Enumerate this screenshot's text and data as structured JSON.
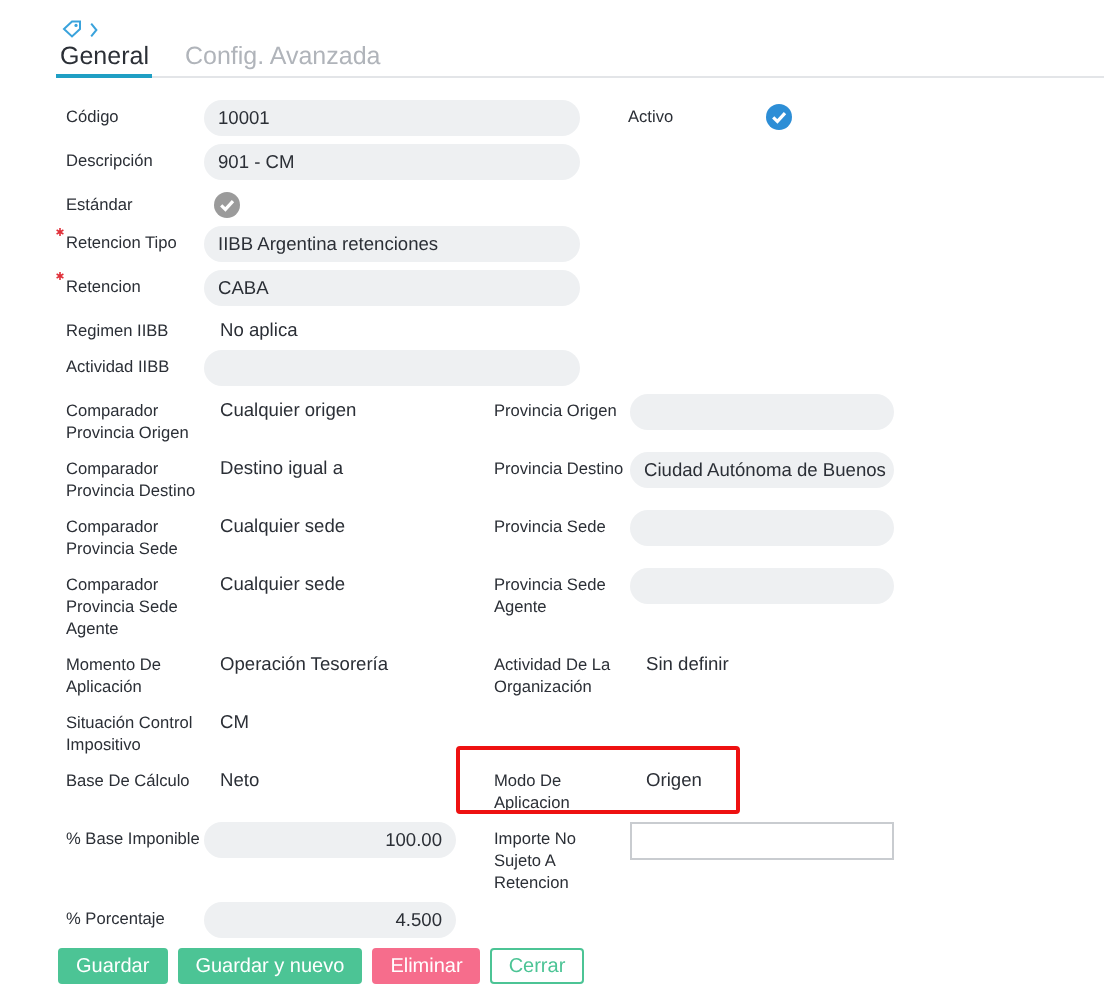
{
  "tabs": [
    {
      "label": "General",
      "selected": true
    },
    {
      "label": "Config. Avanzada",
      "selected": false
    }
  ],
  "sections": [
    {
      "kind": "wide",
      "rows": [
        {
          "cells": [
            {
              "label": "Código",
              "required": false,
              "kind": "input",
              "value": "10001"
            },
            {
              "label": "Activo",
              "required": false,
              "kind": "check",
              "checked": true,
              "disabled": false
            }
          ]
        },
        {
          "cells": [
            {
              "label": "Descripción",
              "required": false,
              "kind": "input",
              "value": "901 - CM"
            }
          ]
        },
        {
          "cells": [
            {
              "label": "Estándar",
              "required": false,
              "kind": "check",
              "checked": true,
              "disabled": true
            }
          ]
        },
        {
          "cells": [
            {
              "label": "Retencion Tipo",
              "required": true,
              "kind": "input",
              "value": "IIBB Argentina retenciones"
            }
          ]
        },
        {
          "cells": [
            {
              "label": "Retencion",
              "required": true,
              "kind": "input",
              "value": "CABA"
            }
          ]
        },
        {
          "cells": [
            {
              "label": "Regimen IIBB",
              "required": false,
              "kind": "text",
              "value": "No aplica"
            }
          ]
        },
        {
          "cells": [
            {
              "label": "Actividad IIBB",
              "required": false,
              "kind": "input"
            }
          ]
        }
      ]
    },
    {
      "kind": "split",
      "rows": [
        {
          "cells": [
            {
              "label": "Comparador Provincia Origen",
              "required": false,
              "highlighted": false,
              "kind": "text",
              "value": "Cualquier origen"
            },
            {
              "label": "Provincia Origen",
              "required": false,
              "highlighted": false,
              "kind": "input"
            }
          ]
        },
        {
          "cells": [
            {
              "label": "Comparador Provincia Destino",
              "required": false,
              "highlighted": false,
              "kind": "text",
              "value": "Destino igual a"
            },
            {
              "label": "Provincia Destino",
              "required": false,
              "highlighted": false,
              "kind": "input",
              "value": "Ciudad Autónoma de Buenos"
            }
          ]
        },
        {
          "cells": [
            {
              "label": "Comparador Provincia Sede",
              "required": false,
              "highlighted": false,
              "kind": "text",
              "value": "Cualquier sede"
            },
            {
              "label": "Provincia Sede",
              "required": false,
              "highlighted": false,
              "kind": "input"
            }
          ]
        },
        {
          "cells": [
            {
              "label": "Comparador Provincia Sede Agente",
              "required": false,
              "highlighted": false,
              "kind": "text",
              "value": "Cualquier sede"
            },
            {
              "label": "Provincia Sede Agente",
              "required": false,
              "highlighted": false,
              "kind": "input"
            }
          ]
        },
        {
          "cells": [
            {
              "label": "Momento De Aplicación",
              "required": false,
              "highlighted": false,
              "kind": "text",
              "value": "Operación Tesorería"
            },
            {
              "label": "Actividad De La Organización",
              "required": false,
              "highlighted": false,
              "kind": "text",
              "value": "Sin definir"
            }
          ]
        },
        {
          "cells": [
            {
              "label": "Situación Control Impositivo",
              "required": false,
              "highlighted": false,
              "kind": "text",
              "value": "CM"
            }
          ]
        },
        {
          "cells": [
            {
              "label": "Base De Cálculo",
              "required": false,
              "highlighted": false,
              "kind": "text",
              "value": "Neto"
            },
            {
              "label": "Modo De Aplicacion",
              "required": false,
              "highlighted": true,
              "kind": "text",
              "value": "Origen"
            }
          ]
        },
        {
          "cells": [
            {
              "label": "% Base Imponible",
              "required": false,
              "highlighted": false,
              "kind": "number",
              "value": "100.00"
            },
            {
              "label": "Importe No Sujeto A Retencion",
              "required": false,
              "highlighted": false,
              "kind": "box"
            }
          ]
        },
        {
          "cells": [
            {
              "label": "% Porcentaje",
              "required": false,
              "highlighted": false,
              "kind": "number",
              "value": "4.500"
            }
          ]
        }
      ]
    }
  ],
  "buttons": [
    {
      "label": "Guardar",
      "kind": "primary"
    },
    {
      "label": "Guardar y nuevo",
      "kind": "primary"
    },
    {
      "label": "Eliminar",
      "kind": "danger"
    },
    {
      "label": "Cerrar",
      "kind": "outline"
    }
  ]
}
